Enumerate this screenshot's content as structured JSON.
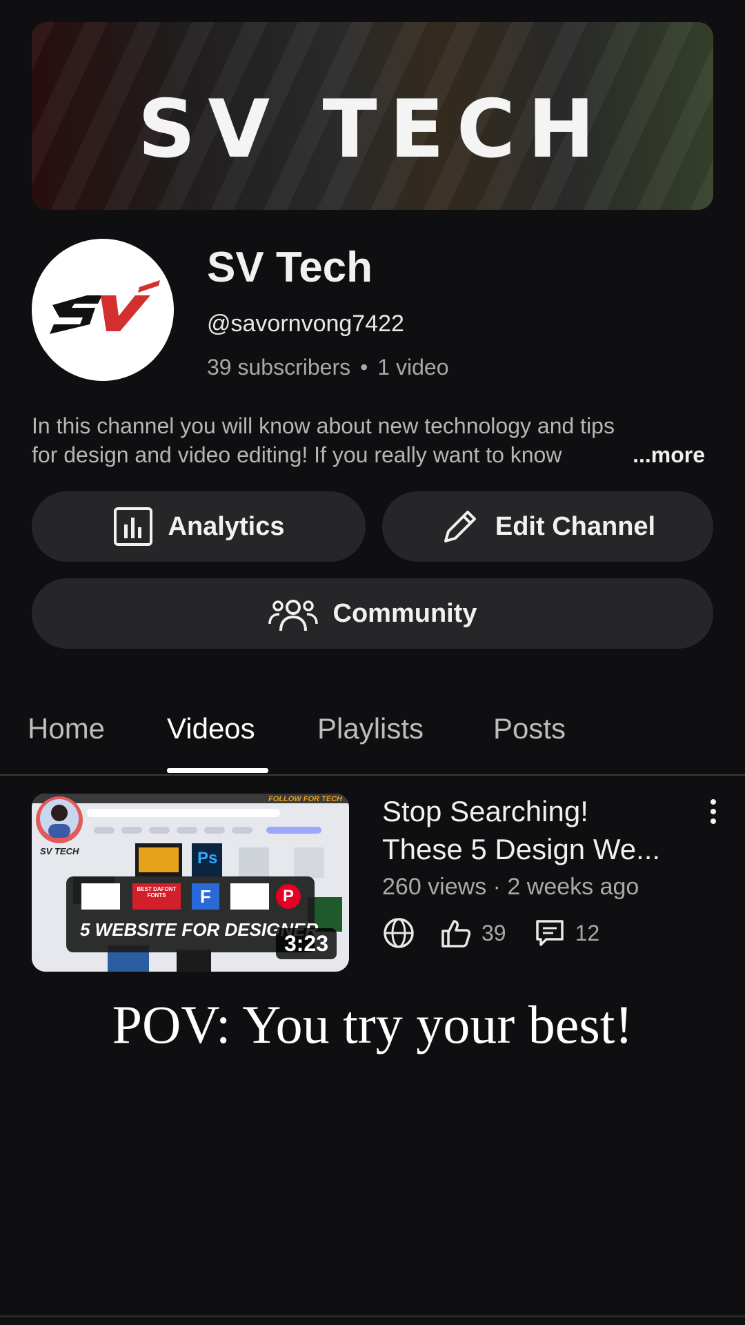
{
  "banner": {
    "title": "SV TECH"
  },
  "channel": {
    "name": "SV Tech",
    "handle": "@savornvong7422",
    "subscribers": "39 subscribers",
    "separator": "•",
    "videos": "1 video",
    "description_line1": "In this channel you will know about new technology and tips",
    "description_line2": "for design and video editing! If you really want to know",
    "more_label": "...more"
  },
  "buttons": {
    "analytics": "Analytics",
    "edit_channel": "Edit Channel",
    "community": "Community"
  },
  "tabs": [
    {
      "label": "Home"
    },
    {
      "label": "Videos"
    },
    {
      "label": "Playlists"
    },
    {
      "label": "Posts"
    }
  ],
  "video": {
    "title_line1": "Stop Searching!",
    "title_line2": "These 5 Design We...",
    "meta": "260 views · 2 weeks ago",
    "likes": "39",
    "comments": "12",
    "duration": "3:23",
    "thumbnail_text": "5 WEBSITE FOR DESIGNER",
    "thumbnail_brand": "SV TECH",
    "thumbnail_tag": "FOLLOW FOR TECH",
    "thumbnail_fonts_label": "BEST DAFONT FONTS",
    "thumbnail_ps": "Ps",
    "thumbnail_f": "F",
    "thumbnail_p": "P"
  },
  "caption": "POV: You try your best!",
  "icons": {
    "analytics": "bar-chart-icon",
    "edit": "pencil-icon",
    "community": "people-icon",
    "visibility": "globe-icon",
    "likes": "thumbs-up-icon",
    "comments": "comment-icon",
    "menu": "more-vertical-icon"
  },
  "colors": {
    "background": "#0f0f11",
    "button": "#262628",
    "accent_red": "#d32f2f"
  }
}
